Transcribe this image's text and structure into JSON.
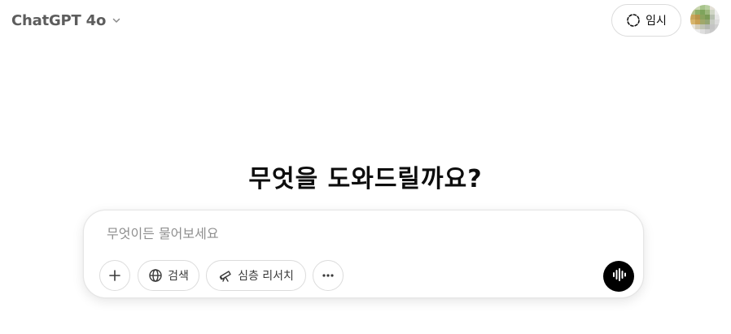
{
  "header": {
    "model_name": "ChatGPT 4o",
    "temporary_label": "임시"
  },
  "main": {
    "headline": "무엇을 도와드릴까요?"
  },
  "composer": {
    "placeholder": "무엇이든 물어보세요",
    "tools": {
      "search_label": "검색",
      "deep_research_label": "심층 리서치"
    }
  },
  "icons": {
    "chevron": "chevron-down-icon",
    "temporary": "dashed-circle-icon",
    "attach": "plus-icon",
    "search": "globe-icon",
    "deep_research": "telescope-icon",
    "more": "more-horizontal-icon",
    "voice": "voice-waveform-icon"
  },
  "colors": {
    "text_primary": "#0d0d0d",
    "text_muted": "#5d5d5d",
    "placeholder": "#8f8f8f",
    "border": "#dcdcdc",
    "voice_button": "#000000"
  }
}
